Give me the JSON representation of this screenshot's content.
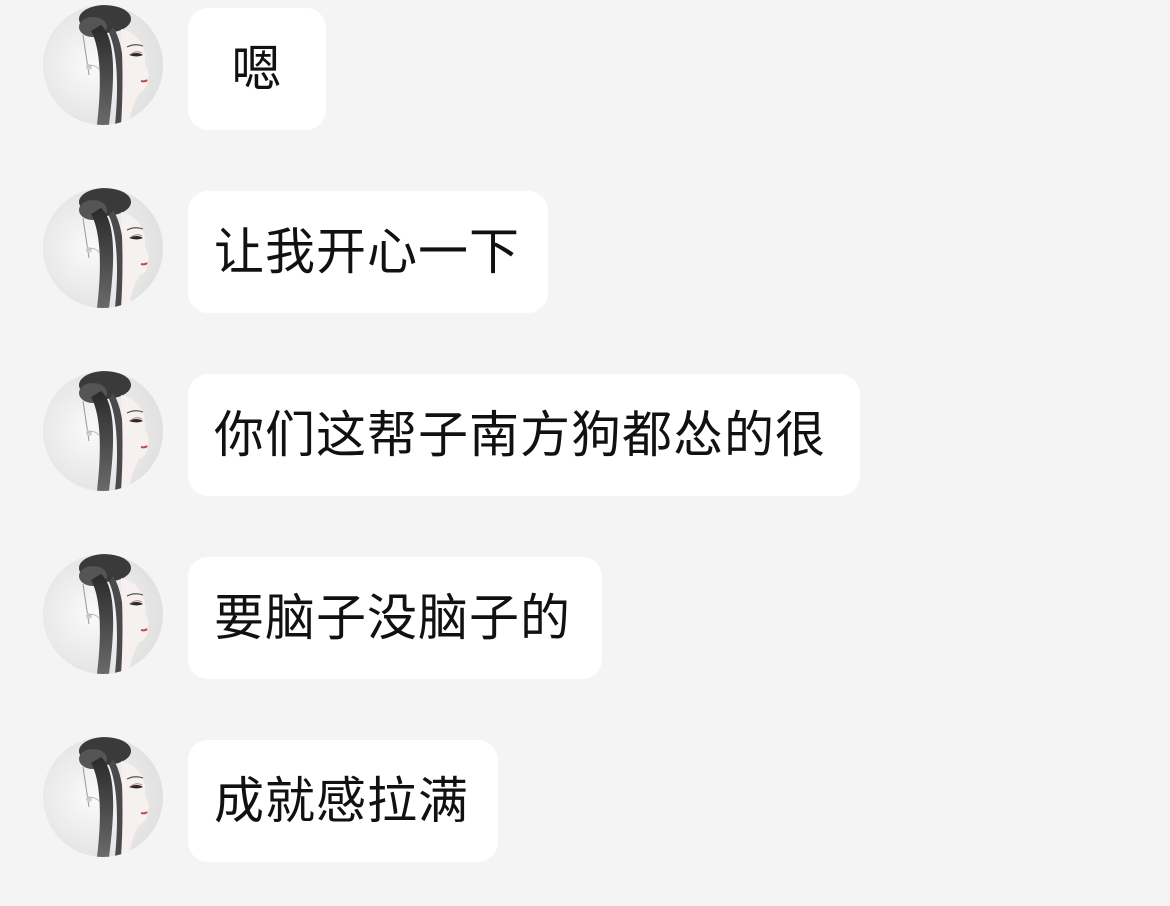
{
  "messages": [
    {
      "sender": "other",
      "avatar_icon": "ink-painting-woman-avatar",
      "text": "嗯"
    },
    {
      "sender": "other",
      "avatar_icon": "ink-painting-woman-avatar",
      "text": "让我开心一下"
    },
    {
      "sender": "other",
      "avatar_icon": "ink-painting-woman-avatar",
      "text": "你们这帮子南方狗都怂的很"
    },
    {
      "sender": "other",
      "avatar_icon": "ink-painting-woman-avatar",
      "text": "要脑子没脑子的"
    },
    {
      "sender": "other",
      "avatar_icon": "ink-painting-woman-avatar",
      "text": "成就感拉满"
    }
  ],
  "colors": {
    "background": "#f4f4f4",
    "bubble": "#ffffff",
    "text": "#111111"
  }
}
